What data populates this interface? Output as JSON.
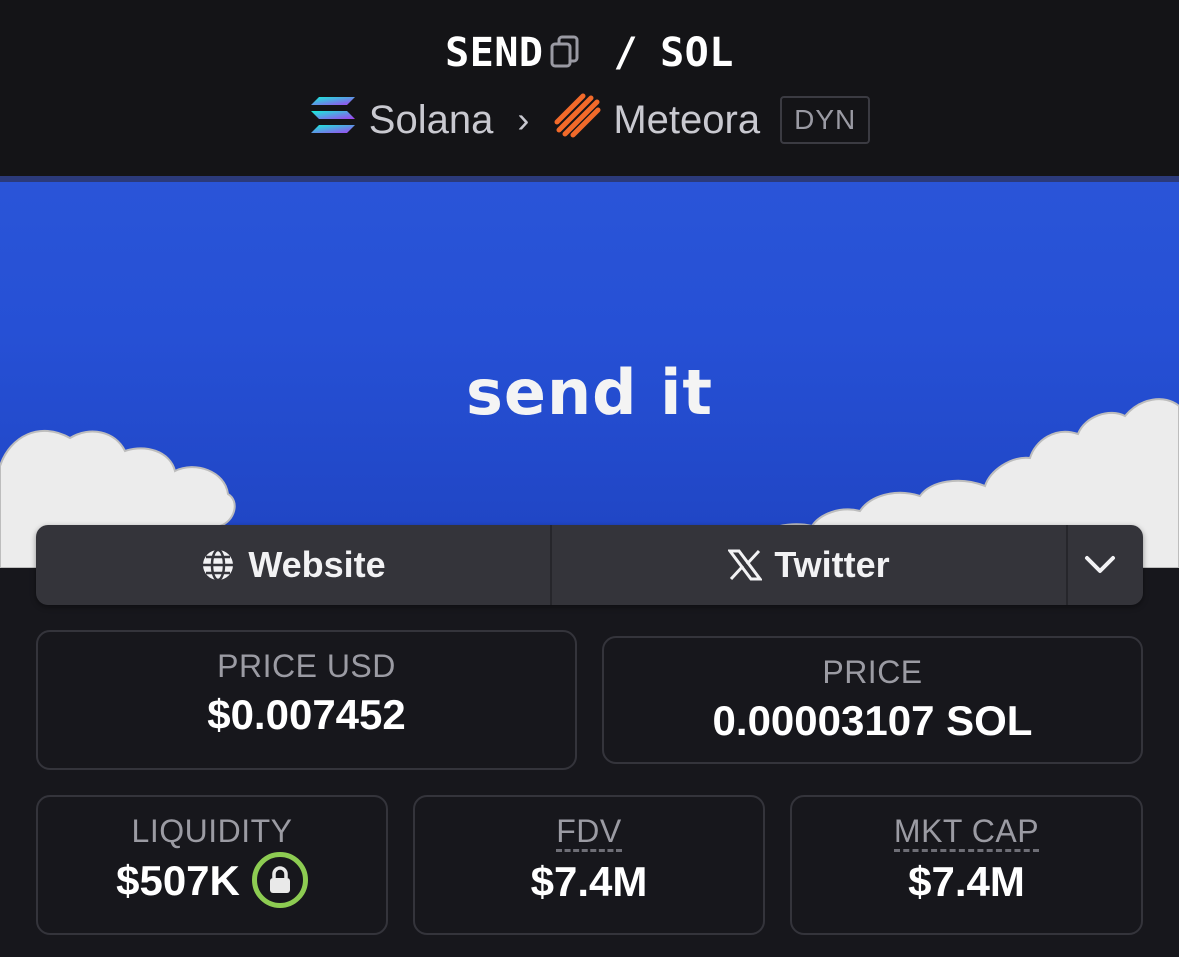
{
  "header": {
    "base_token": "SEND",
    "quote_token": "SOL",
    "separator": "/",
    "chain": "Solana",
    "dex": "Meteora",
    "pool_tag": "DYN"
  },
  "banner": {
    "text": "send it",
    "bg_color": "#2650d5"
  },
  "links": {
    "website_label": "Website",
    "twitter_label": "Twitter"
  },
  "stats": {
    "price_usd_label": "PRICE USD",
    "price_usd_value": "$0.007452",
    "price_label": "PRICE",
    "price_value": "0.00003107 SOL",
    "liquidity_label": "LIQUIDITY",
    "liquidity_value": "$507K",
    "fdv_label": "FDV",
    "fdv_value": "$7.4M",
    "mktcap_label": "MKT CAP",
    "mktcap_value": "$7.4M"
  },
  "icons": {
    "copy": "copy-icon",
    "solana": "solana-logo-icon",
    "meteora": "meteora-logo-icon",
    "chevron": "chevron-right-icon",
    "globe": "globe-icon",
    "x": "x-logo-icon",
    "dropdown": "chevron-down-icon",
    "lock": "lock-icon"
  },
  "colors": {
    "lock_ring": "#8dcc52",
    "card_border": "#34343b",
    "background": "#17171c"
  }
}
